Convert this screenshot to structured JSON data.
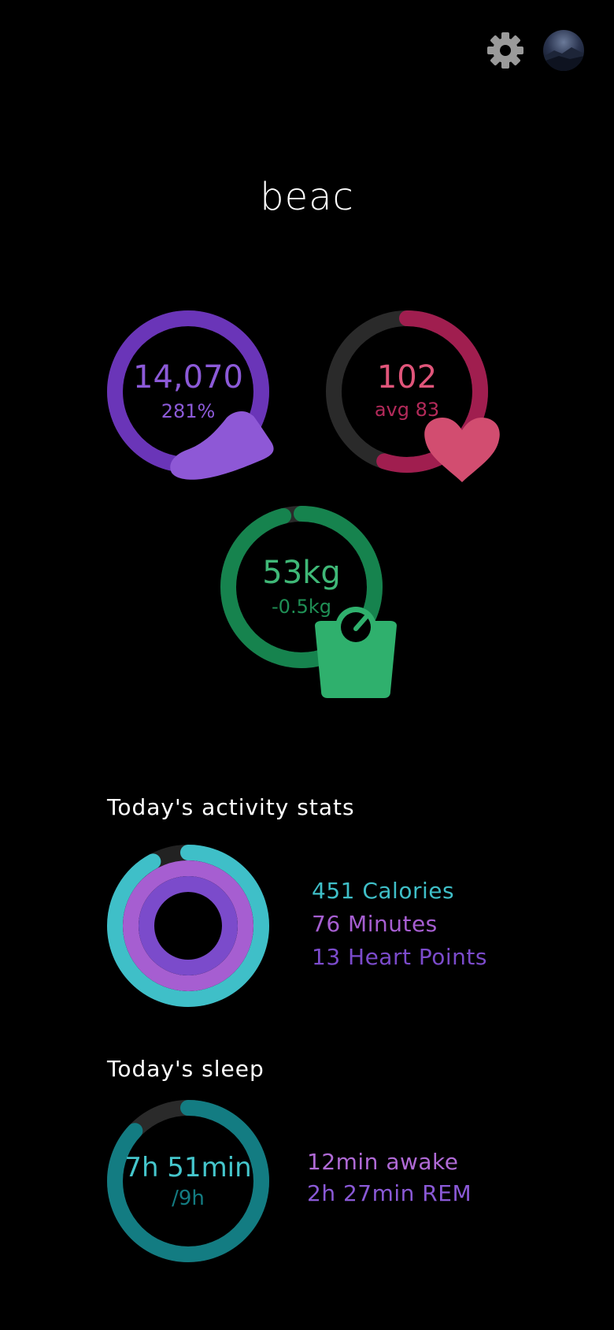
{
  "header": {
    "app_name": "beac",
    "settings_icon": "gear-icon",
    "avatar_icon": "avatar"
  },
  "metrics": {
    "steps": {
      "value": "14,070",
      "percent": "281%",
      "icon": "shoe-icon",
      "color": "#8454d6",
      "progress": 1.0
    },
    "heart": {
      "value": "102",
      "sub": "avg 83",
      "icon": "heart-icon",
      "color": "#c62f5c",
      "progress": 0.55
    },
    "weight": {
      "value": "53kg",
      "sub": "-0.5kg",
      "icon": "scale-icon",
      "color": "#16834e",
      "progress": 0.96
    }
  },
  "activity": {
    "title": "Today's activity stats",
    "calories": "451 Calories",
    "minutes": "76 Minutes",
    "heart_points": "13 Heart Points",
    "colors": {
      "calories": "#3fbfc8",
      "minutes": "#a65ed1",
      "heart_points": "#7b4bcb"
    },
    "progress": {
      "calories": 0.92,
      "minutes": 1.0,
      "heart_points": 1.0
    }
  },
  "sleep": {
    "title": "Today's sleep",
    "duration": "7h 51min",
    "goal": "/9h",
    "awake": "12min awake",
    "rem": "2h 27min REM",
    "colors": {
      "ring": "#137c82",
      "awake": "#b06ad6",
      "rem": "#8a59d6"
    },
    "progress": 0.87
  }
}
